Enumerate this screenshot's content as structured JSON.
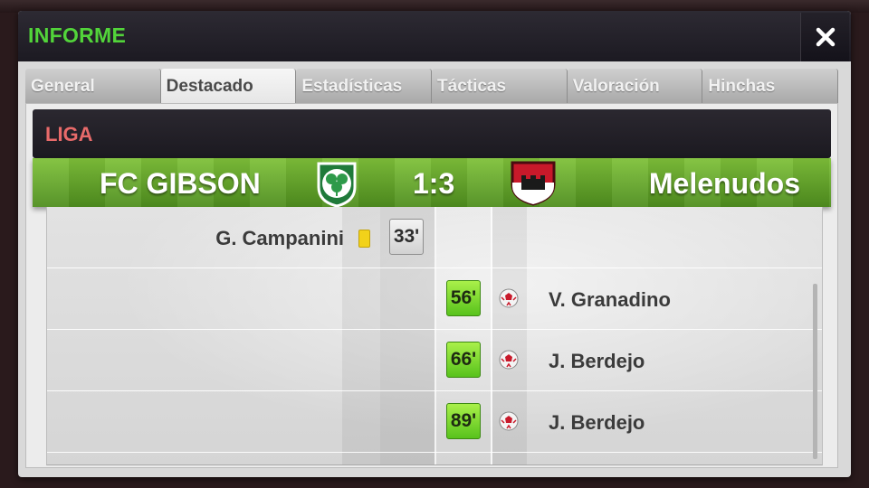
{
  "header": {
    "title": "INFORME",
    "close_label": "✕"
  },
  "tabs": [
    {
      "label": "General",
      "active": false
    },
    {
      "label": "Destacado",
      "active": true
    },
    {
      "label": "Estadísticas",
      "active": false
    },
    {
      "label": "Tácticas",
      "active": false
    },
    {
      "label": "Valoración",
      "active": false
    },
    {
      "label": "Hinchas",
      "active": false
    }
  ],
  "match": {
    "competition": "LIGA",
    "home_team": "FC GIBSON",
    "away_team": "Melenudos",
    "score": "1:3",
    "home_crest": "clover-crest-icon",
    "away_crest": "red-castle-crest-icon"
  },
  "events": [
    {
      "side": "home",
      "player": "G. Campanini",
      "minute": "33'",
      "type": "yellow-card"
    },
    {
      "side": "away",
      "player": "V. Granadino",
      "minute": "56'",
      "type": "goal"
    },
    {
      "side": "away",
      "player": "J. Berdejo",
      "minute": "66'",
      "type": "goal"
    },
    {
      "side": "away",
      "player": "J. Berdejo",
      "minute": "89'",
      "type": "goal"
    }
  ],
  "colors": {
    "title_green": "#52d43a",
    "league_red": "#e86a6a",
    "pitch_green": "#6aa82c",
    "goal_minute_green": "#7ad934",
    "yellow_card": "#f2d21a"
  }
}
